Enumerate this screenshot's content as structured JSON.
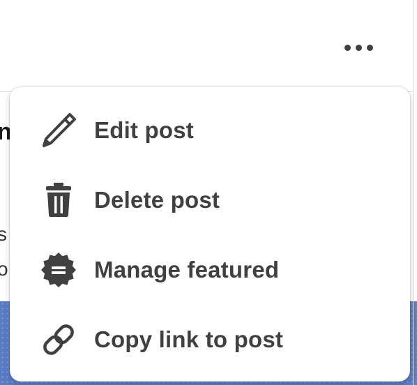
{
  "post_header": {
    "more_actions_icon": "ellipsis-horizontal-icon"
  },
  "menu": {
    "items": [
      {
        "label": "Edit post",
        "icon": "pencil-icon"
      },
      {
        "label": "Delete post",
        "icon": "trash-icon"
      },
      {
        "label": "Manage featured",
        "icon": "featured-badge-icon"
      },
      {
        "label": "Copy link to post",
        "icon": "link-icon"
      }
    ]
  },
  "colors": {
    "menu_text": "#404040",
    "icon": "#404040",
    "banner": "#5b7bc4"
  }
}
